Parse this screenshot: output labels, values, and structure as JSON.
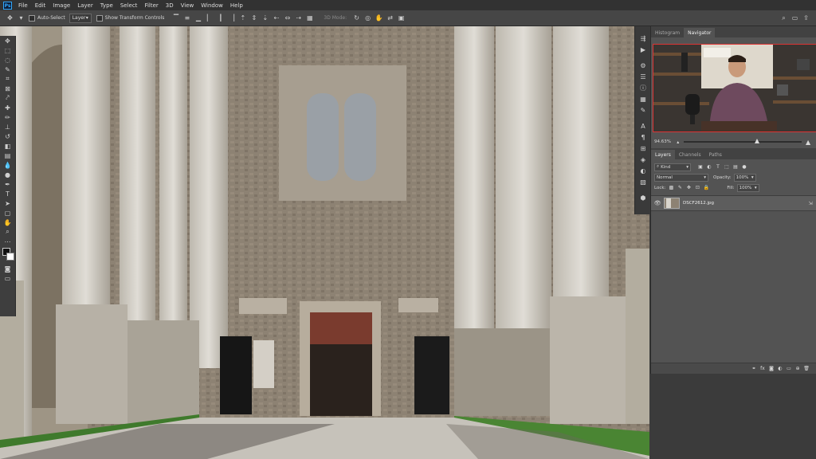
{
  "app": {
    "logo": "Ps"
  },
  "menu": [
    "File",
    "Edit",
    "Image",
    "Layer",
    "Type",
    "Select",
    "Filter",
    "3D",
    "View",
    "Window",
    "Help"
  ],
  "options": {
    "auto_select_label": "Auto-Select",
    "auto_select_target": "Layer",
    "show_transform_label": "Show Transform Controls",
    "mode_3d_label": "3D Mode:"
  },
  "panels": {
    "top_tabs": [
      "Histogram",
      "Navigator"
    ],
    "top_active": "Navigator",
    "navigator": {
      "zoom": "94.63%",
      "zoom_slider_fraction": 0.62
    },
    "layer_tabs": [
      "Layers",
      "Channels",
      "Paths"
    ],
    "layer_active": "Layers",
    "filter_kind": "Kind",
    "blend_mode": "Normal",
    "opacity_label": "Opacity:",
    "opacity_value": "100%",
    "lock_label": "Lock:",
    "fill_label": "Fill:",
    "fill_value": "100%",
    "layer": {
      "name": "DSCF2612.jpg"
    }
  },
  "colors": {
    "accent": "#31a8ff",
    "panel_bg": "#535353",
    "layer_selected": "#5d5d5d"
  }
}
